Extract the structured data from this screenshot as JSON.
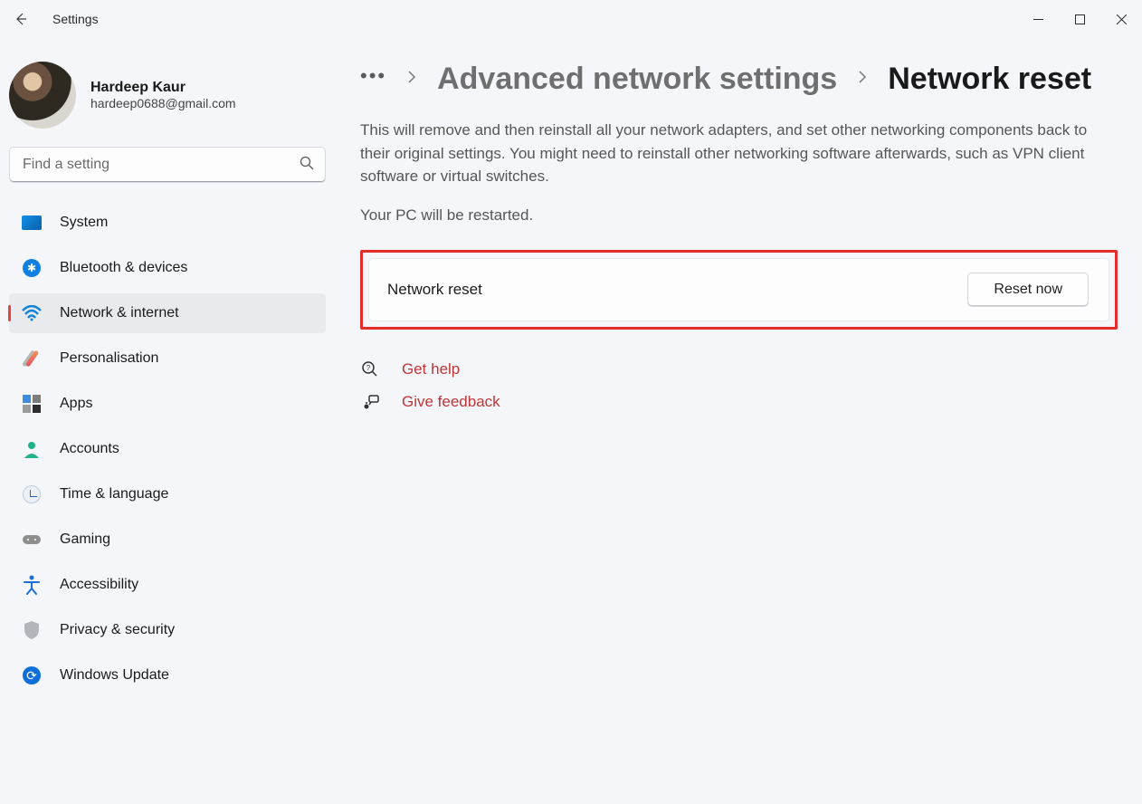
{
  "app_title": "Settings",
  "user": {
    "name": "Hardeep Kaur",
    "email": "hardeep0688@gmail.com"
  },
  "search": {
    "placeholder": "Find a setting"
  },
  "sidebar": {
    "items": [
      {
        "label": "System"
      },
      {
        "label": "Bluetooth & devices"
      },
      {
        "label": "Network & internet"
      },
      {
        "label": "Personalisation"
      },
      {
        "label": "Apps"
      },
      {
        "label": "Accounts"
      },
      {
        "label": "Time & language"
      },
      {
        "label": "Gaming"
      },
      {
        "label": "Accessibility"
      },
      {
        "label": "Privacy & security"
      },
      {
        "label": "Windows Update"
      }
    ],
    "selected_index": 2
  },
  "breadcrumb": {
    "parent": "Advanced network settings",
    "current": "Network reset"
  },
  "main": {
    "description": "This will remove and then reinstall all your network adapters, and set other networking components back to their original settings. You might need to reinstall other networking software afterwards, such as VPN client software or virtual switches.",
    "restart_note": "Your PC will be restarted.",
    "card_title": "Network reset",
    "reset_button": "Reset now"
  },
  "links": {
    "help": "Get help",
    "feedback": "Give feedback"
  }
}
